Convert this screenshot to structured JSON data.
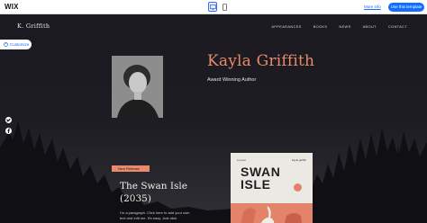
{
  "editor": {
    "logo": "WIX",
    "more_info": "More info",
    "use_template": "Use this template",
    "devices": [
      "desktop-icon",
      "mobile-icon"
    ]
  },
  "site": {
    "logo": "K. Griffith",
    "nav": [
      "APPEARANCES",
      "BOOKS",
      "NEWS",
      "ABOUT",
      "CONTACT"
    ],
    "customize": "Customize",
    "author_name": "Kayla Griffith",
    "author_subtitle": "Award Winning Author",
    "badge": "New Release",
    "book_title": "The Swan Isle (2035)",
    "book_description": "I'm a paragraph. Click here to add your own text and edit me. It's easy. Just click",
    "cover": {
      "left_label": "a novel",
      "right_label": "kayla griffith",
      "title": "SWAN ISLE"
    }
  },
  "colors": {
    "accent": "#e98a6b",
    "editor_blue": "#116dff",
    "background": "#1d1c22"
  }
}
